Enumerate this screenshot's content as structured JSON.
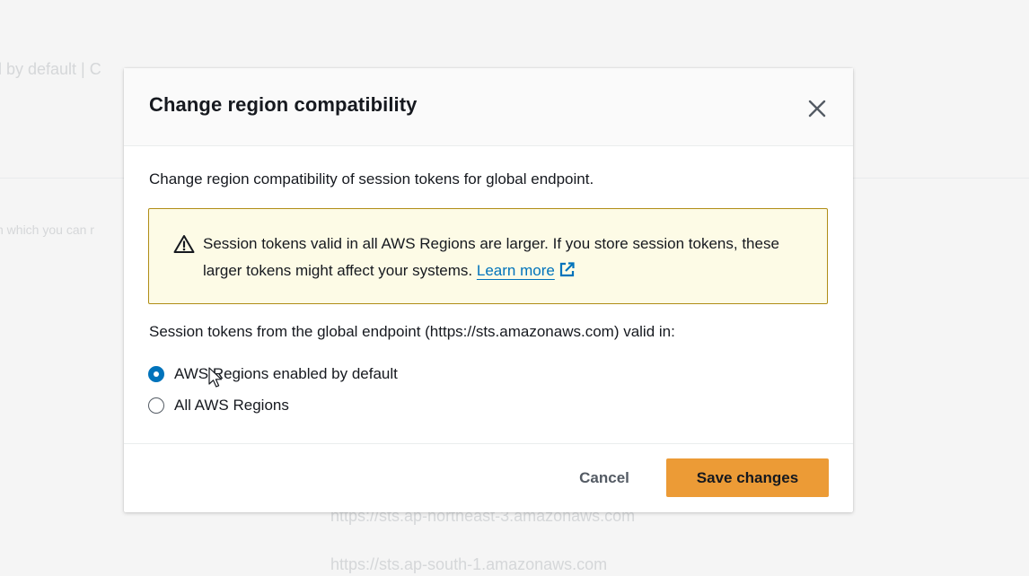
{
  "background": {
    "text_fragment_1": "l by default  |  C",
    "text_fragment_2": "n which you can r",
    "url_1": "https://sts.ap-northeast-3.amazonaws.com",
    "url_2": "https://sts.ap-south-1.amazonaws.com"
  },
  "modal": {
    "title": "Change region compatibility",
    "close_icon": "close-icon",
    "description": "Change region compatibility of session tokens for global endpoint.",
    "alert": {
      "icon": "warning-icon",
      "text": "Session tokens valid in all AWS Regions are larger. If you store session tokens, these larger tokens might affect your systems.",
      "link_label": "Learn more",
      "link_icon": "external-link-icon"
    },
    "question": "Session tokens from the global endpoint (https://sts.amazonaws.com) valid in:",
    "options": [
      {
        "label": "AWS Regions enabled by default",
        "selected": true
      },
      {
        "label": "All AWS Regions",
        "selected": false
      }
    ],
    "footer": {
      "cancel_label": "Cancel",
      "save_label": "Save changes"
    }
  },
  "colors": {
    "primary_button": "#ec9b36",
    "link": "#0073bb",
    "radio_selected": "#0073bb",
    "alert_background": "#fdfbe6",
    "alert_border": "#b08d16"
  }
}
